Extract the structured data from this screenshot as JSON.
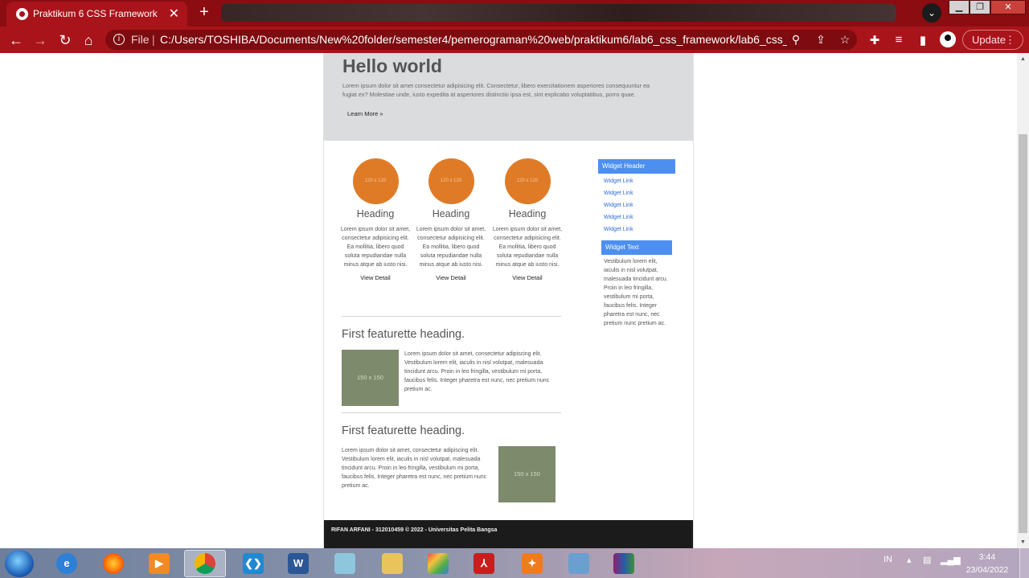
{
  "browser": {
    "tab_title": "Praktikum 6 CSS Framework",
    "tab_close": "✕",
    "new_tab": "+",
    "scheme_label": "File",
    "url": "C:/Users/TOSHIBA/Documents/New%20folder/semester4/pemerograman%20web/praktikum6/lab6_css_framework/lab6_css_framew...",
    "update_label": "Update",
    "accent_color": "#a8141a"
  },
  "hero": {
    "title": "Hello world",
    "text": "Lorem ipsum dolor sit amet consectetur adipisicing elit. Consectetur, libero exercitationem asperiores consequuntur ea fugiat ex? Molestiae unde, iusto expedita at asperiores distinctio ipsa est, sint explicabo voluptatibus, porro quae.",
    "link": "Learn More »"
  },
  "columns": [
    {
      "placeholder": "120 x 120",
      "heading": "Heading",
      "text": "Lorem ipsum dolor sit amet, consectetur adipisicing elit. Ea mollitia, libero quod soluta repudiandae nulla minus atque ab iusto nisi.",
      "link": "View Detail"
    },
    {
      "placeholder": "120 x 120",
      "heading": "Heading",
      "text": "Lorem ipsum dolor sit amet, consectetur adipisicing elit. Ea mollitia, libero quod soluta repudiandae nulla minus atque ab iusto nisi.",
      "link": "View Detail"
    },
    {
      "placeholder": "120 x 120",
      "heading": "Heading",
      "text": "Lorem ipsum dolor sit amet, consectetur adipisicing elit. Ea mollitia, libero quod soluta repudiandae nulla minus atque ab iusto nisi.",
      "link": "View Detail"
    }
  ],
  "featurettes": [
    {
      "heading": "First featurette heading.",
      "placeholder": "150 x 150",
      "text": "Lorem ipsum dolor sit amet, consectetur adipiscing elit. Vestibulum lorem elit, iaculis in nisl volutpat, malesuada tincidunt arcu. Proin in leo fringilla, vestibulum mi porta, faucibus felis. Integer pharetra est nunc, nec pretium nunc pretium ac."
    },
    {
      "heading": "First featurette heading.",
      "placeholder": "150 x 150",
      "text": "Lorem ipsum dolor sit amet, consectetur adipiscing elit. Vestibulum lorem elit, iaculis in nisl volutpat, malesuada tincidunt arcu. Proin in leo fringilla, vestibulum mi porta, faucibus felis. Integer pharetra est nunc, nec pretium nunc pretium ac."
    }
  ],
  "widget": {
    "header": "Widget Header",
    "links": [
      "Widget Link",
      "Widget Link",
      "Widget Link",
      "Widget Link",
      "Widget Link"
    ],
    "text_header": "Widget Text",
    "text": "Vestibulum lorem elit, iaculis in nisl volutpat, malesuada tincidunt arcu. Proin in leo fringilla, vestibulum mi porta, faucibus felis. Integer pharetra est nunc, nec pretium nunc pretium ac."
  },
  "footer": {
    "text": "RIFAN ARFANI - 312010459 © 2022 - Universitas Pelita Bangsa"
  },
  "taskbar": {
    "language": "IN",
    "time": "3:44",
    "date": "23/04/2022",
    "word_label": "W"
  }
}
